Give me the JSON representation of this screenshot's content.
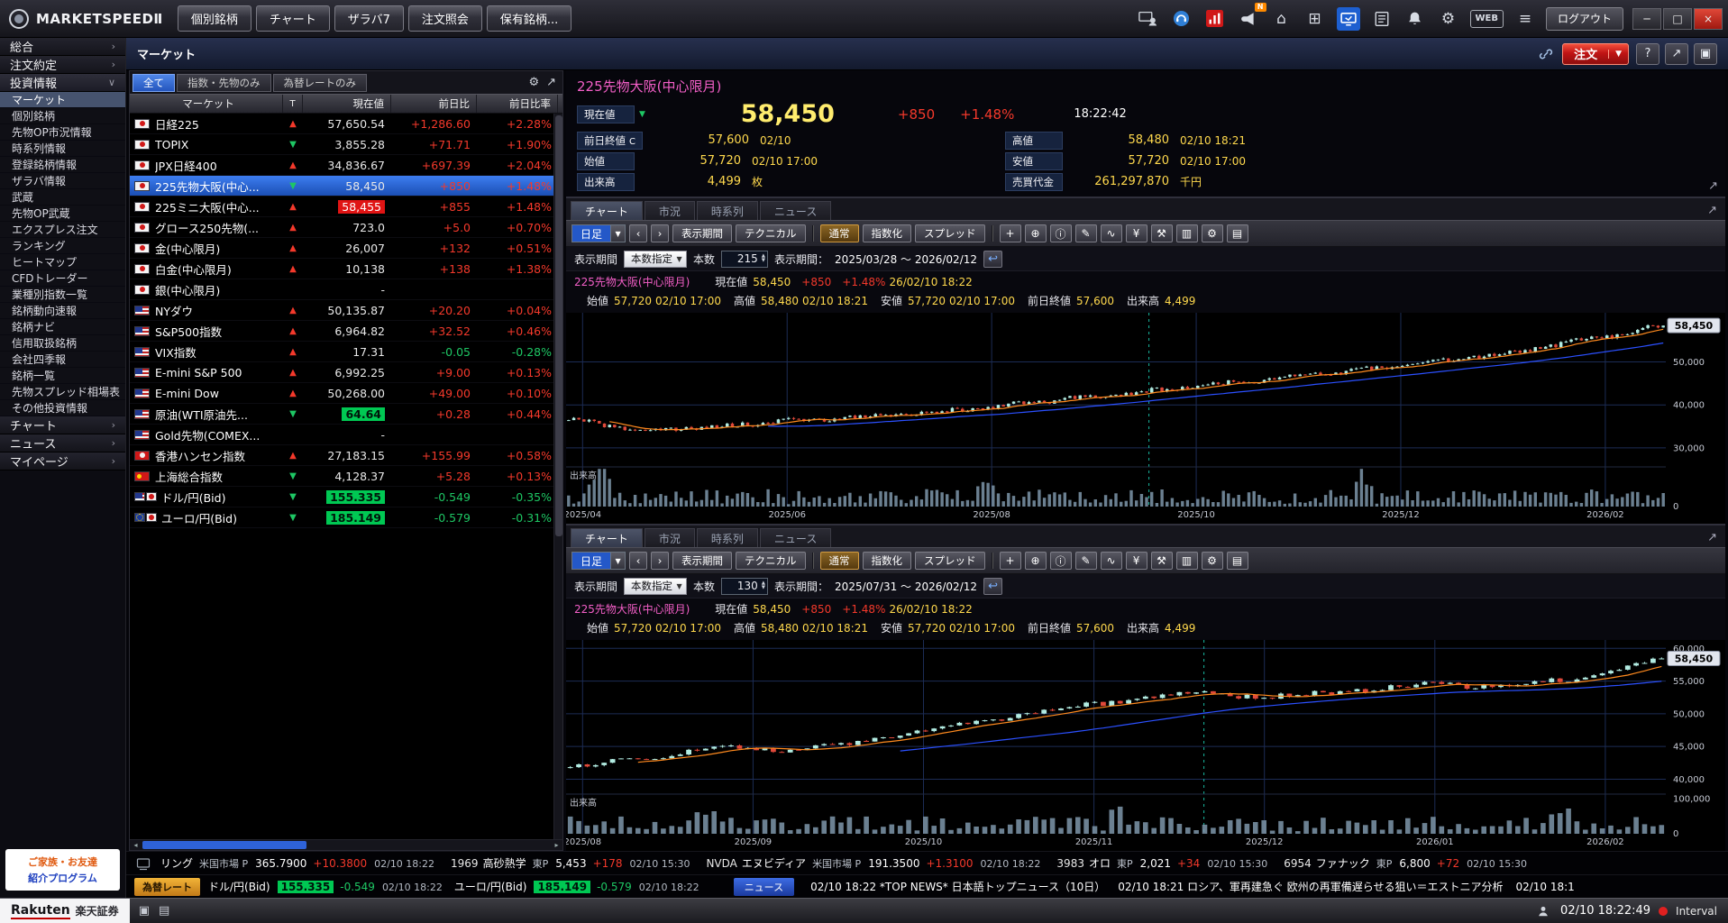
{
  "top_bar": {
    "logo_text": "MARKETSPEEDⅡ",
    "tabs": [
      "個別銘柄",
      "チャート",
      "ザラバ7",
      "注文照会",
      "保有銘柄..."
    ],
    "icons": [
      {
        "name": "screen-share-icon"
      },
      {
        "name": "support-icon"
      },
      {
        "name": "stock-app-icon"
      },
      {
        "name": "announce-icon",
        "badge": "N"
      },
      {
        "name": "home-icon",
        "glyph": "⌂"
      },
      {
        "name": "add-window-icon",
        "glyph": "⊞"
      },
      {
        "name": "monitor-icon",
        "active": true
      },
      {
        "name": "news-list-icon"
      },
      {
        "name": "bell-icon"
      },
      {
        "name": "settings-gear-icon",
        "glyph": "⚙"
      },
      {
        "name": "web-badge",
        "glyph": "WEB",
        "boxed": true
      },
      {
        "name": "menu-icon",
        "glyph": "≡"
      }
    ],
    "logout_label": "ログアウト",
    "window_controls": [
      {
        "name": "minimize-button",
        "glyph": "─"
      },
      {
        "name": "maximize-button",
        "glyph": "□"
      },
      {
        "name": "close-button",
        "glyph": "×",
        "close": true
      }
    ]
  },
  "sidebar": {
    "sections": [
      {
        "label": "総合"
      },
      {
        "label": "注文約定"
      },
      {
        "label": "投資情報",
        "expanded": true,
        "selected": "マーケット",
        "items": [
          "マーケット",
          "個別銘柄",
          "先物OP市況情報",
          "時系列情報",
          "登録銘柄情報",
          "ザラバ情報",
          "武蔵",
          "先物OP武蔵",
          "エクスプレス注文",
          "ランキング",
          "ヒートマップ",
          "CFDトレーダー",
          "業種別指数一覧",
          "銘柄動向速報",
          "銘柄ナビ",
          "信用取扱銘柄",
          "会社四季報",
          "銘柄一覧",
          "先物スプレッド相場表",
          "その他投資情報"
        ]
      },
      {
        "label": "チャート"
      },
      {
        "label": "ニュース"
      },
      {
        "label": "マイページ"
      }
    ],
    "ad": {
      "line1": "ご家族・お友達",
      "line2": "紹介プログラム"
    }
  },
  "page": {
    "title": "マーケット",
    "order_label": "注文",
    "right_icons": [
      {
        "name": "help-button",
        "glyph": "?"
      },
      {
        "name": "popout-button",
        "glyph": "↗"
      },
      {
        "name": "layout-button",
        "glyph": "▣"
      }
    ]
  },
  "watchlist": {
    "filters": [
      "全て",
      "指数・先物のみ",
      "為替レートのみ"
    ],
    "active_filter": "全て",
    "icons": [
      {
        "name": "watchlist-settings-icon",
        "glyph": "⚙"
      },
      {
        "name": "watchlist-expand-icon",
        "glyph": "↗"
      }
    ],
    "columns": [
      "マーケット",
      "T",
      "現在値",
      "前日比",
      "前日比率"
    ],
    "rows": [
      {
        "flag": "jp",
        "name": "日経225",
        "dir": "up",
        "price": "57,650.54",
        "chg": "+1,286.60",
        "pct": "+2.28%",
        "cc": "up"
      },
      {
        "flag": "jp",
        "name": "TOPIX",
        "dir": "down",
        "price": "3,855.28",
        "chg": "+71.71",
        "pct": "+1.90%",
        "cc": "up"
      },
      {
        "flag": "jp",
        "name": "JPX日経400",
        "dir": "up",
        "price": "34,836.67",
        "chg": "+697.39",
        "pct": "+2.04%",
        "cc": "up"
      },
      {
        "flag": "jp",
        "name": "225先物大阪(中心...",
        "dir": "down",
        "price": "58,450",
        "chg": "+850",
        "pct": "+1.48%",
        "cc": "up",
        "selected": true
      },
      {
        "flag": "jp",
        "name": "225ミニ大阪(中心...",
        "dir": "up",
        "price": "58,455",
        "chg": "+855",
        "pct": "+1.48%",
        "cc": "up",
        "hl": "red"
      },
      {
        "flag": "jp",
        "name": "グロース250先物(...",
        "dir": "up",
        "price": "723.0",
        "chg": "+5.0",
        "pct": "+0.70%",
        "cc": "up"
      },
      {
        "flag": "jp",
        "name": "金(中心限月)",
        "dir": "up",
        "price": "26,007",
        "chg": "+132",
        "pct": "+0.51%",
        "cc": "up"
      },
      {
        "flag": "jp",
        "name": "白金(中心限月)",
        "dir": "up",
        "price": "10,138",
        "chg": "+138",
        "pct": "+1.38%",
        "cc": "up"
      },
      {
        "flag": "jp",
        "name": "銀(中心限月)",
        "dir": "",
        "price": "-",
        "chg": "",
        "pct": "",
        "cc": ""
      },
      {
        "flag": "us",
        "name": "NYダウ",
        "dir": "up",
        "price": "50,135.87",
        "chg": "+20.20",
        "pct": "+0.04%",
        "cc": "up"
      },
      {
        "flag": "us",
        "name": "S&P500指数",
        "dir": "up",
        "price": "6,964.82",
        "chg": "+32.52",
        "pct": "+0.46%",
        "cc": "up"
      },
      {
        "flag": "us",
        "name": "VIX指数",
        "dir": "up",
        "price": "17.31",
        "chg": "-0.05",
        "pct": "-0.28%",
        "cc": "down"
      },
      {
        "flag": "us",
        "name": "E-mini S&P 500",
        "dir": "up",
        "price": "6,992.25",
        "chg": "+9.00",
        "pct": "+0.13%",
        "cc": "up"
      },
      {
        "flag": "us",
        "name": "E-mini Dow",
        "dir": "up",
        "price": "50,268.00",
        "chg": "+49.00",
        "pct": "+0.10%",
        "cc": "up"
      },
      {
        "flag": "us",
        "name": "原油(WTI原油先...",
        "dir": "down",
        "price": "64.64",
        "chg": "+0.28",
        "pct": "+0.44%",
        "cc": "up",
        "hl": "green"
      },
      {
        "flag": "us",
        "name": "Gold先物(COMEX...",
        "dir": "",
        "price": "-",
        "chg": "",
        "pct": "",
        "cc": ""
      },
      {
        "flag": "hk",
        "name": "香港ハンセン指数",
        "dir": "up",
        "price": "27,183.15",
        "chg": "+155.99",
        "pct": "+0.58%",
        "cc": "up"
      },
      {
        "flag": "cn",
        "name": "上海総合指数",
        "dir": "down",
        "price": "4,128.37",
        "chg": "+5.28",
        "pct": "+0.13%",
        "cc": "up"
      },
      {
        "flag": [
          "us",
          "jp"
        ],
        "name": "ドル/円(Bid)",
        "dir": "down",
        "price": "155.335",
        "chg": "-0.549",
        "pct": "-0.35%",
        "cc": "down",
        "hl": "green"
      },
      {
        "flag": [
          "eu",
          "jp"
        ],
        "name": "ユーロ/円(Bid)",
        "dir": "down",
        "price": "185.149",
        "chg": "-0.579",
        "pct": "-0.31%",
        "cc": "down",
        "hl": "green"
      }
    ]
  },
  "quote": {
    "name": "225先物大阪(中心限月)",
    "price_label": "現在値",
    "price": "58,450",
    "change": "+850",
    "pct": "+1.48%",
    "time": "18:22:42",
    "rows": [
      {
        "l": "前日終値",
        "sup": "C",
        "v": "57,600",
        "d": "02/10",
        "l2": "高値",
        "v2": "58,480",
        "d2": "02/10 18:21"
      },
      {
        "l": "始値",
        "sup": "",
        "v": "57,720",
        "d": "02/10 17:00",
        "l2": "安値",
        "v2": "57,720",
        "d2": "02/10 17:00"
      },
      {
        "l": "出来高",
        "sup": "",
        "v": "4,499",
        "d": "枚",
        "l2": "売買代金",
        "v2": "261,297,870",
        "d2": "千円"
      }
    ]
  },
  "panels": [
    {
      "tabs": [
        "チャート",
        "市況",
        "時系列",
        "ニュース"
      ],
      "active_tab": 0,
      "toolbar": {
        "interval": "日足",
        "nav": [
          "‹",
          "›"
        ],
        "buttons": [
          "表示期間",
          "テクニカル"
        ],
        "modes": [
          {
            "label": "通常",
            "active": true
          },
          {
            "label": "指数化"
          },
          {
            "label": "スプレッド"
          }
        ],
        "icons": [
          {
            "name": "add-icon",
            "glyph": "+"
          },
          {
            "name": "zoom-in-icon",
            "glyph": "⊕"
          },
          {
            "name": "info-icon",
            "glyph": "ⓘ"
          },
          {
            "name": "draw-icon",
            "glyph": "✎"
          },
          {
            "name": "wave-icon",
            "glyph": "∿"
          },
          {
            "name": "currency-icon",
            "glyph": "¥"
          },
          {
            "name": "tools-icon",
            "glyph": "⚒"
          },
          {
            "name": "histogram-icon",
            "glyph": "▥"
          },
          {
            "name": "wrench-icon",
            "glyph": "⚙"
          },
          {
            "name": "print-icon",
            "glyph": "▤"
          }
        ]
      },
      "period": {
        "label": "表示期間",
        "mode": "本数指定",
        "count_label": "本数",
        "count": "215",
        "range_label": "表示期間：",
        "range": "2025/03/28 ～ 2026/02/12"
      },
      "legend1": [
        {
          "t": "225先物大阪(中心限月)",
          "c": "magenta",
          "n": "legend-instrument"
        },
        {
          "t": "現在値",
          "c": "lbl"
        },
        {
          "t": "58,450",
          "c": "val"
        },
        {
          "t": "+850",
          "c": "up"
        },
        {
          "t": "+1.48%",
          "c": "up"
        },
        {
          "t": "26/02/10 18:22",
          "c": "val"
        }
      ],
      "legend2": [
        {
          "t": "始値",
          "c": "lbl"
        },
        {
          "t": "57,720",
          "c": "val"
        },
        {
          "t": "02/10 17:00",
          "c": "val"
        },
        {
          "t": "高値",
          "c": "lbl"
        },
        {
          "t": "58,480",
          "c": "val"
        },
        {
          "t": "02/10 18:21",
          "c": "val"
        },
        {
          "t": "安値",
          "c": "lbl"
        },
        {
          "t": "57,720",
          "c": "val"
        },
        {
          "t": "02/10 17:00",
          "c": "val"
        },
        {
          "t": "前日終値",
          "c": "lbl"
        },
        {
          "t": "57,600",
          "c": "val"
        },
        {
          "t": "出来高",
          "c": "lbl"
        },
        {
          "t": "4,499",
          "c": "val"
        }
      ]
    },
    {
      "tabs": [
        "チャート",
        "市況",
        "時系列",
        "ニュース"
      ],
      "active_tab": 0,
      "toolbar": {
        "interval": "日足",
        "nav": [
          "‹",
          "›"
        ],
        "buttons": [
          "表示期間",
          "テクニカル"
        ],
        "modes": [
          {
            "label": "通常",
            "active": true
          },
          {
            "label": "指数化"
          },
          {
            "label": "スプレッド"
          }
        ],
        "icons": [
          {
            "name": "add-icon",
            "glyph": "+"
          },
          {
            "name": "zoom-in-icon",
            "glyph": "⊕"
          },
          {
            "name": "info-icon",
            "glyph": "ⓘ"
          },
          {
            "name": "draw-icon",
            "glyph": "✎"
          },
          {
            "name": "wave-icon",
            "glyph": "∿"
          },
          {
            "name": "currency-icon",
            "glyph": "¥"
          },
          {
            "name": "tools-icon",
            "glyph": "⚒"
          },
          {
            "name": "histogram-icon",
            "glyph": "▥"
          },
          {
            "name": "wrench-icon",
            "glyph": "⚙"
          },
          {
            "name": "print-icon",
            "glyph": "▤"
          }
        ]
      },
      "period": {
        "label": "表示期間",
        "mode": "本数指定",
        "count_label": "本数",
        "count": "130",
        "range_label": "表示期間：",
        "range": "2025/07/31 ～ 2026/02/12"
      },
      "legend1": [
        {
          "t": "225先物大阪(中心限月)",
          "c": "magenta",
          "n": "legend-instrument"
        },
        {
          "t": "現在値",
          "c": "lbl"
        },
        {
          "t": "58,450",
          "c": "val"
        },
        {
          "t": "+850",
          "c": "up"
        },
        {
          "t": "+1.48%",
          "c": "up"
        },
        {
          "t": "26/02/10 18:22",
          "c": "val"
        }
      ],
      "legend2": [
        {
          "t": "始値",
          "c": "lbl"
        },
        {
          "t": "57,720",
          "c": "val"
        },
        {
          "t": "02/10 17:00",
          "c": "val"
        },
        {
          "t": "高値",
          "c": "lbl"
        },
        {
          "t": "58,480",
          "c": "val"
        },
        {
          "t": "02/10 18:21",
          "c": "val"
        },
        {
          "t": "安値",
          "c": "lbl"
        },
        {
          "t": "57,720",
          "c": "val"
        },
        {
          "t": "02/10 17:00",
          "c": "val"
        },
        {
          "t": "前日終値",
          "c": "lbl"
        },
        {
          "t": "57,600",
          "c": "val"
        },
        {
          "t": "出来高",
          "c": "lbl"
        },
        {
          "t": "4,499",
          "c": "val"
        }
      ]
    }
  ],
  "chart_data": [
    {
      "type": "candlestick",
      "title": "225先物大阪(中心限月) 日足",
      "bars": 215,
      "seed": 7,
      "x_labels": [
        "2025/04",
        "2025/06",
        "2025/08",
        "2025/10",
        "2025/12",
        "2026/02"
      ],
      "y_ticks": [
        30000,
        40000,
        50000
      ],
      "y_tick_labels": [
        "30,000",
        "40,000",
        "50,000"
      ],
      "y_range": [
        26000,
        61000
      ],
      "anchors": [
        36600,
        34000,
        34900,
        36300,
        37100,
        38300,
        39900,
        41600,
        43200,
        45000,
        46700,
        48400,
        50200,
        52400,
        55300,
        58450
      ],
      "last": 58450,
      "last_label": "58,450",
      "volume_label": "出来高",
      "volume_ticks": [
        {
          "label": "0",
          "f": 1
        }
      ],
      "volume_spikes": [
        {
          "pos": 0.03,
          "mult": 6
        },
        {
          "pos": 0.38,
          "mult": 2.4
        },
        {
          "pos": 0.72,
          "mult": 2.0
        }
      ],
      "marker_pos": 0.53,
      "up_color": "#b2ece2",
      "down_color": "#e0493a",
      "ma_colors": [
        "#ff8a1e",
        "#2b50ff"
      ],
      "grid": true,
      "legend_position": "top"
    },
    {
      "type": "candlestick",
      "title": "225先物大阪(中心限月) 日足",
      "bars": 130,
      "seed": 13,
      "x_labels": [
        "2025/08",
        "2025/09",
        "2025/10",
        "2025/11",
        "2025/12",
        "2026/01",
        "2026/02"
      ],
      "y_ticks": [
        40000,
        45000,
        50000,
        55000,
        60000
      ],
      "y_tick_labels": [
        "40,000",
        "45,000",
        "50,000",
        "55,000",
        "60,000"
      ],
      "y_range": [
        38000,
        61000
      ],
      "anchors": [
        41800,
        43400,
        44900,
        44400,
        46300,
        48300,
        50300,
        51900,
        53100,
        52600,
        53500,
        54500,
        54100,
        55500,
        58450
      ],
      "last": 58450,
      "last_label": "58,450",
      "volume_label": "出来高",
      "volume_ticks": [
        {
          "label": "100,000",
          "f": 0.12
        },
        {
          "label": "0",
          "f": 1
        }
      ],
      "volume_spikes": [
        {
          "pos": 0.12,
          "mult": 3.2
        },
        {
          "pos": 0.5,
          "mult": 2.2
        },
        {
          "pos": 0.9,
          "mult": 2.4
        }
      ],
      "marker_pos": 0.58,
      "up_color": "#b2ece2",
      "down_color": "#e0493a",
      "ma_colors": [
        "#ff8a1e",
        "#2b50ff"
      ],
      "grid": true,
      "legend_position": "top"
    }
  ],
  "ticker1": {
    "items": [
      {
        "code": "",
        "name": "リング",
        "market": "米国市場 P",
        "price": "365.7900",
        "chg": "+10.3800",
        "time": "02/10 18:22",
        "cc": "up"
      },
      {
        "code": "1969",
        "name": "高砂熱学",
        "market": "東P",
        "price": "5,453",
        "chg": "+178",
        "time": "02/10 15:30",
        "cc": "up"
      },
      {
        "code": "NVDA",
        "name": "エヌビディア",
        "market": "米国市場 P",
        "price": "191.3500",
        "chg": "+1.3100",
        "time": "02/10 18:22",
        "cc": "up"
      },
      {
        "code": "3983",
        "name": "オロ",
        "market": "東P",
        "price": "2,021",
        "chg": "+34",
        "time": "02/10 15:30",
        "cc": "up"
      },
      {
        "code": "6954",
        "name": "ファナック",
        "market": "東P",
        "price": "6,800",
        "chg": "+72",
        "time": "02/10 15:30",
        "cc": "up"
      }
    ]
  },
  "ticker2": {
    "fx_label": "為替レート",
    "fx_items": [
      {
        "name": "ドル/円(Bid)",
        "price": "155.335",
        "chg": "-0.549",
        "time": "02/10 18:22"
      },
      {
        "name": "ユーロ/円(Bid)",
        "price": "185.149",
        "chg": "-0.579",
        "time": "02/10 18:22"
      }
    ],
    "news_label": "ニュース",
    "news_items": [
      "02/10 18:22 *TOP NEWS* 日本語トップニュース（10日）",
      "02/10 18:21 ロシア、軍再建急ぐ 欧州の再軍備遅らせる狙い＝エストニア分析",
      "02/10 18:1"
    ]
  },
  "statusbar": {
    "brand": "Rakuten",
    "brand2": "楽天証券",
    "icons": [
      {
        "name": "window-dock-icon",
        "glyph": "▣"
      },
      {
        "name": "window-split-icon",
        "glyph": "▤"
      }
    ],
    "time": "02/10 18:22:49",
    "interval_label": "Interval"
  }
}
